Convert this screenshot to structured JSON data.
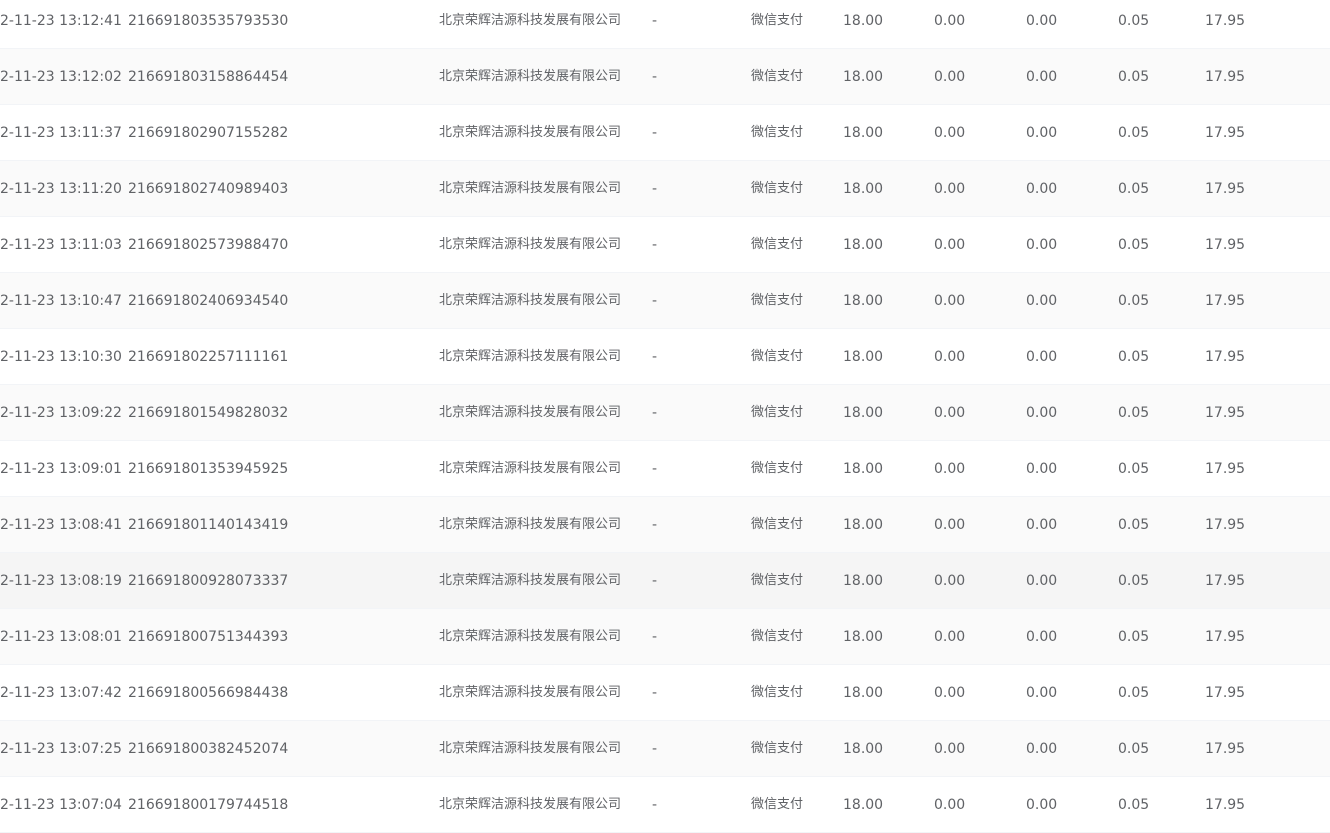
{
  "table": {
    "rows": [
      {
        "time": "2-11-23 13:12:41",
        "order_no": "216691803535793530",
        "merchant": "北京荣辉洁源科技发展有限公司",
        "remark": "-",
        "pay_method": "微信支付",
        "amount": "18.00",
        "discount": "0.00",
        "refund": "0.00",
        "fee": "0.05",
        "net": "17.95"
      },
      {
        "time": "2-11-23 13:12:02",
        "order_no": "216691803158864454",
        "merchant": "北京荣辉洁源科技发展有限公司",
        "remark": "-",
        "pay_method": "微信支付",
        "amount": "18.00",
        "discount": "0.00",
        "refund": "0.00",
        "fee": "0.05",
        "net": "17.95"
      },
      {
        "time": "2-11-23 13:11:37",
        "order_no": "216691802907155282",
        "merchant": "北京荣辉洁源科技发展有限公司",
        "remark": "-",
        "pay_method": "微信支付",
        "amount": "18.00",
        "discount": "0.00",
        "refund": "0.00",
        "fee": "0.05",
        "net": "17.95"
      },
      {
        "time": "2-11-23 13:11:20",
        "order_no": "216691802740989403",
        "merchant": "北京荣辉洁源科技发展有限公司",
        "remark": "-",
        "pay_method": "微信支付",
        "amount": "18.00",
        "discount": "0.00",
        "refund": "0.00",
        "fee": "0.05",
        "net": "17.95"
      },
      {
        "time": "2-11-23 13:11:03",
        "order_no": "216691802573988470",
        "merchant": "北京荣辉洁源科技发展有限公司",
        "remark": "-",
        "pay_method": "微信支付",
        "amount": "18.00",
        "discount": "0.00",
        "refund": "0.00",
        "fee": "0.05",
        "net": "17.95"
      },
      {
        "time": "2-11-23 13:10:47",
        "order_no": "216691802406934540",
        "merchant": "北京荣辉洁源科技发展有限公司",
        "remark": "-",
        "pay_method": "微信支付",
        "amount": "18.00",
        "discount": "0.00",
        "refund": "0.00",
        "fee": "0.05",
        "net": "17.95"
      },
      {
        "time": "2-11-23 13:10:30",
        "order_no": "216691802257111161",
        "merchant": "北京荣辉洁源科技发展有限公司",
        "remark": "-",
        "pay_method": "微信支付",
        "amount": "18.00",
        "discount": "0.00",
        "refund": "0.00",
        "fee": "0.05",
        "net": "17.95"
      },
      {
        "time": "2-11-23 13:09:22",
        "order_no": "216691801549828032",
        "merchant": "北京荣辉洁源科技发展有限公司",
        "remark": "-",
        "pay_method": "微信支付",
        "amount": "18.00",
        "discount": "0.00",
        "refund": "0.00",
        "fee": "0.05",
        "net": "17.95"
      },
      {
        "time": "2-11-23 13:09:01",
        "order_no": "216691801353945925",
        "merchant": "北京荣辉洁源科技发展有限公司",
        "remark": "-",
        "pay_method": "微信支付",
        "amount": "18.00",
        "discount": "0.00",
        "refund": "0.00",
        "fee": "0.05",
        "net": "17.95"
      },
      {
        "time": "2-11-23 13:08:41",
        "order_no": "216691801140143419",
        "merchant": "北京荣辉洁源科技发展有限公司",
        "remark": "-",
        "pay_method": "微信支付",
        "amount": "18.00",
        "discount": "0.00",
        "refund": "0.00",
        "fee": "0.05",
        "net": "17.95"
      },
      {
        "time": "2-11-23 13:08:19",
        "order_no": "216691800928073337",
        "merchant": "北京荣辉洁源科技发展有限公司",
        "remark": "-",
        "pay_method": "微信支付",
        "amount": "18.00",
        "discount": "0.00",
        "refund": "0.00",
        "fee": "0.05",
        "net": "17.95"
      },
      {
        "time": "2-11-23 13:08:01",
        "order_no": "216691800751344393",
        "merchant": "北京荣辉洁源科技发展有限公司",
        "remark": "-",
        "pay_method": "微信支付",
        "amount": "18.00",
        "discount": "0.00",
        "refund": "0.00",
        "fee": "0.05",
        "net": "17.95"
      },
      {
        "time": "2-11-23 13:07:42",
        "order_no": "216691800566984438",
        "merchant": "北京荣辉洁源科技发展有限公司",
        "remark": "-",
        "pay_method": "微信支付",
        "amount": "18.00",
        "discount": "0.00",
        "refund": "0.00",
        "fee": "0.05",
        "net": "17.95"
      },
      {
        "time": "2-11-23 13:07:25",
        "order_no": "216691800382452074",
        "merchant": "北京荣辉洁源科技发展有限公司",
        "remark": "-",
        "pay_method": "微信支付",
        "amount": "18.00",
        "discount": "0.00",
        "refund": "0.00",
        "fee": "0.05",
        "net": "17.95"
      },
      {
        "time": "2-11-23 13:07:04",
        "order_no": "216691800179744518",
        "merchant": "北京荣辉洁源科技发展有限公司",
        "remark": "-",
        "pay_method": "微信支付",
        "amount": "18.00",
        "discount": "0.00",
        "refund": "0.00",
        "fee": "0.05",
        "net": "17.95"
      }
    ]
  },
  "colors": {
    "text": "#606266",
    "row_stripe": "#fafafa",
    "row_hover": "#f5f5f5",
    "row_border": "#f2f4f7"
  }
}
